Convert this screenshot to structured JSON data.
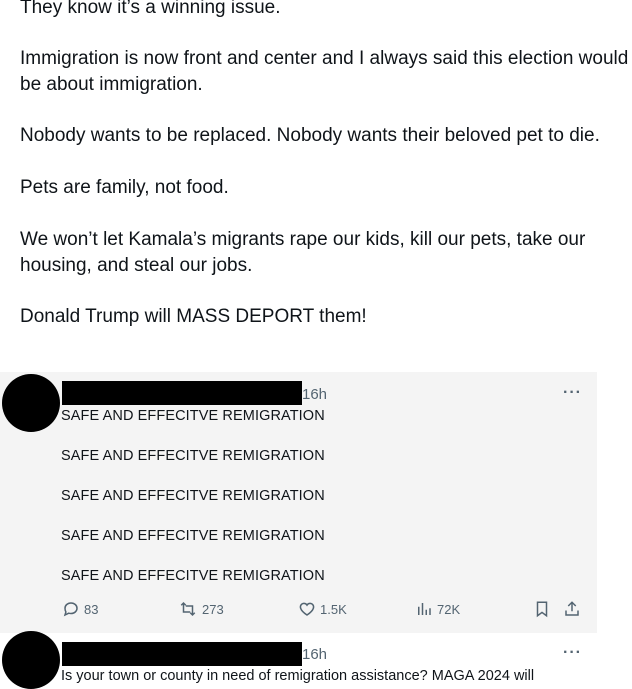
{
  "post": {
    "paragraphs": [
      "They know it’s a winning issue.",
      "Immigration is now front and center and I always said this election would be about immigration.",
      "Nobody wants to be replaced. Nobody wants their beloved pet to die.",
      "Pets are family, not food.",
      "We won’t let Kamala’s migrants rape our kids, kill our pets, take our housing, and steal our jobs.",
      "Donald Trump will MASS DEPORT them!"
    ]
  },
  "replies": [
    {
      "time": "16h",
      "more": "···",
      "lines": [
        "SAFE AND EFFECITVE REMIGRATION",
        "SAFE AND EFFECITVE REMIGRATION",
        "SAFE AND EFFECITVE REMIGRATION",
        "SAFE AND EFFECITVE REMIGRATION",
        "SAFE AND EFFECITVE REMIGRATION"
      ],
      "actions": {
        "replies": "83",
        "reposts": "273",
        "likes": "1.5K",
        "views": "72K"
      }
    },
    {
      "time": "16h",
      "more": "···",
      "partial_text": "Is your town or county in need of remigration assistance? MAGA 2024 will"
    }
  ],
  "colors": {
    "text": "#0f1419",
    "secondary": "#536471",
    "highlight_bg": "#f4f4f4"
  }
}
